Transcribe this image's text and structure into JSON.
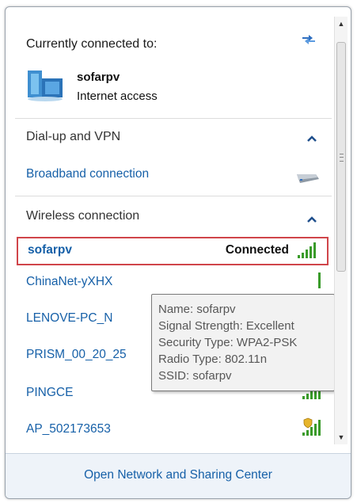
{
  "header": {
    "title": "Currently connected to:",
    "network_name": "sofarpv",
    "network_status": "Internet access"
  },
  "groups": [
    {
      "label": "Dial-up and VPN",
      "items": [
        {
          "label": "Broadband connection"
        }
      ]
    },
    {
      "label": "Wireless connection",
      "items": [
        {
          "label": "sofarpv",
          "status": "Connected"
        },
        {
          "label": "ChinaNet-yXHX"
        },
        {
          "label": "LENOVE-PC_N"
        },
        {
          "label": "PRISM_00_20_25"
        },
        {
          "label": "PINGCE"
        },
        {
          "label": "AP_502173653"
        }
      ]
    }
  ],
  "tooltip": {
    "lines": [
      "Name: sofarpv",
      "Signal Strength: Excellent",
      "Security Type: WPA2-PSK",
      "Radio Type: 802.11n",
      "SSID: sofarpv"
    ]
  },
  "footer": {
    "link": "Open Network and Sharing Center"
  },
  "colors": {
    "link": "#1660a8",
    "selection_border": "#d0454a",
    "signal": "#3a9b2a",
    "footer_bg": "#eef3f9"
  },
  "icons": {
    "refresh": "refresh-icon",
    "network": "network-icon",
    "modem": "modem-icon",
    "signal": "signal-strength-icon",
    "security": "security-shield-icon"
  }
}
